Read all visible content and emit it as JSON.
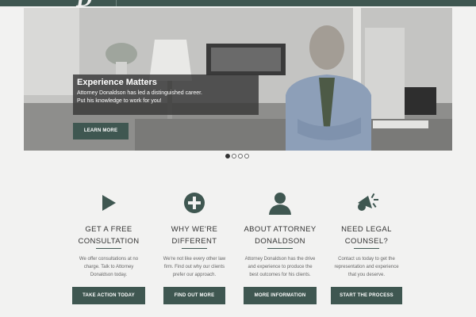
{
  "header": {
    "logo_letter": "D"
  },
  "hero": {
    "title": "Experience Matters",
    "line1": "Attorney Donaldson has led a distinguished career.",
    "line2": "Put his knowledge to work for you!",
    "button_label": "LEARN MORE",
    "slide_count": 4,
    "active_slide": 1
  },
  "features": [
    {
      "icon": "play-icon",
      "heading_line1": "GET A FREE",
      "heading_line2": "CONSULTATION",
      "text_line1": "We offer consultations at no",
      "text_line2": "charge. Talk to Attorney",
      "text_line3": "Donaldson today.",
      "button_label": "TAKE ACTION TODAY"
    },
    {
      "icon": "plus-circle-icon",
      "heading_line1": "WHY WE'RE",
      "heading_line2": "DIFFERENT",
      "text_line1": "We're not like every other law",
      "text_line2": "firm. Find out why our clients",
      "text_line3": "prefer our approach.",
      "button_label": "FIND OUT MORE"
    },
    {
      "icon": "user-icon",
      "heading_line1": "ABOUT ATTORNEY",
      "heading_line2": "DONALDSON",
      "text_line1": "Attorney Donaldson has the drive",
      "text_line2": "and experience to produce the",
      "text_line3": "best outcomes for his clients.",
      "button_label": "MORE INFORMATION"
    },
    {
      "icon": "megaphone-icon",
      "heading_line1": "NEED LEGAL",
      "heading_line2": "COUNSEL?",
      "text_line1": "Contact us today to get the",
      "text_line2": "representation and experience",
      "text_line3": "that you deserve.",
      "button_label": "START THE PROCESS"
    }
  ],
  "colors": {
    "accent": "#3f5751",
    "background": "#f2f2f1"
  }
}
